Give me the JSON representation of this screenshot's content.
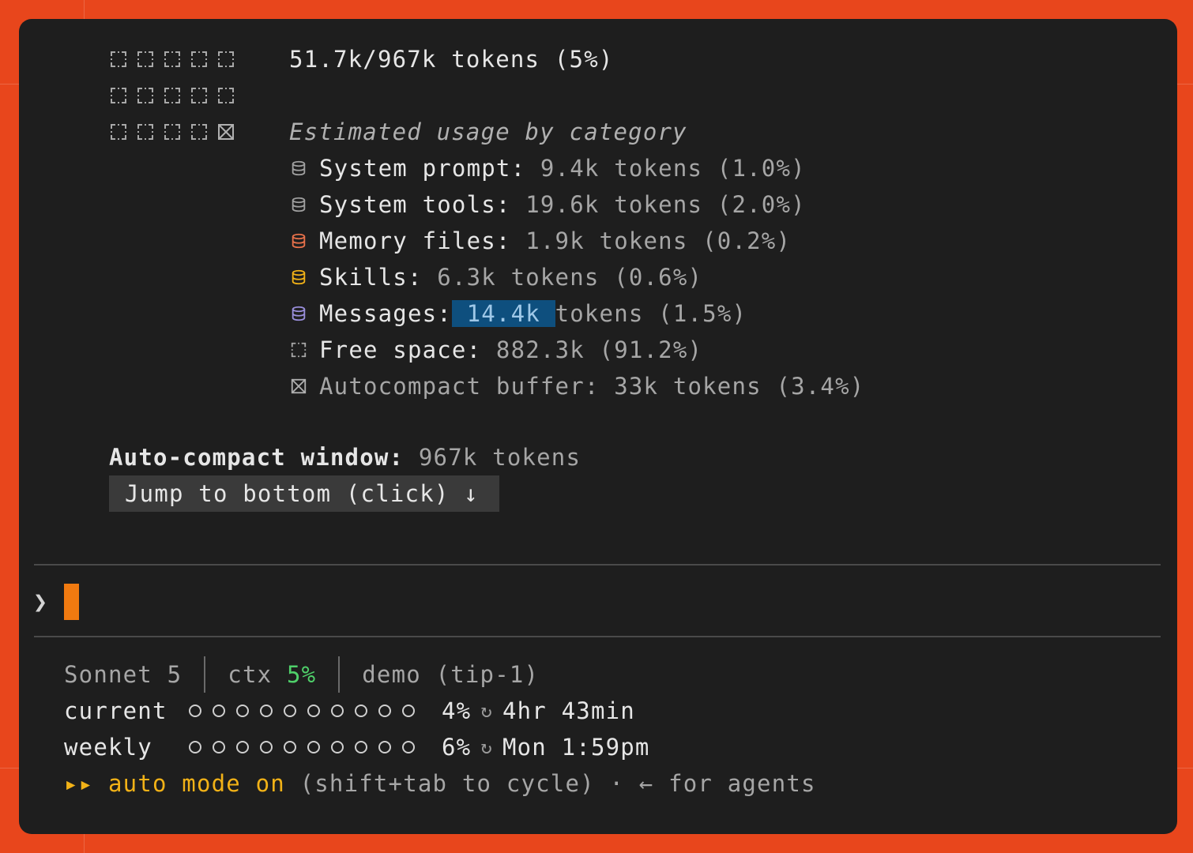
{
  "context": {
    "usage_summary": "51.7k/967k tokens (5%)",
    "heading": "Estimated usage by category",
    "grid": {
      "rows": [
        [
          "free",
          "free",
          "free",
          "free",
          "free"
        ],
        [
          "free",
          "free",
          "free",
          "free",
          "free"
        ],
        [
          "free",
          "free",
          "free",
          "free",
          "buffer"
        ]
      ]
    },
    "categories": [
      {
        "label": "System prompt:",
        "value": "9.4k tokens (1.0%)",
        "icon": "database-icon",
        "color": "#a0a0a0"
      },
      {
        "label": "System tools:",
        "value": "19.6k tokens (2.0%)",
        "icon": "database-icon",
        "color": "#a0a0a0"
      },
      {
        "label": "Memory files:",
        "value": "1.9k tokens (0.2%)",
        "icon": "database-icon",
        "color": "#e8714a"
      },
      {
        "label": "Skills:",
        "value": "6.3k tokens (0.6%)",
        "icon": "database-icon",
        "color": "#f2b217"
      },
      {
        "label": "Messages:",
        "value_highlight": "14.4k",
        "value_rest": "tokens (1.5%)",
        "icon": "database-icon",
        "color": "#9a8fdc"
      },
      {
        "label": "Free space:",
        "value": "882.3k (91.2%)",
        "icon": "free-space-icon",
        "color": "#a0a0a0"
      },
      {
        "label": "Autocompact buffer:",
        "value": "33k tokens (3.4%)",
        "icon": "buffer-icon",
        "color": "#a0a0a0"
      }
    ],
    "autocompact_label": "Auto-compact window:",
    "autocompact_value": "967k tokens",
    "jump_button": "Jump to bottom (click) ↓"
  },
  "prompt": {
    "glyph": "❯"
  },
  "statusline": {
    "model": "Sonnet 5",
    "ctx_label": "ctx",
    "ctx_value": "5%",
    "branch": "demo (tip-1)",
    "current_label": "current",
    "current_pct": "4%",
    "current_level": 0.04,
    "current_reset": "4hr 43min",
    "weekly_label": "weekly",
    "weekly_pct": "6%",
    "weekly_level": 0.06,
    "weekly_reset": "Mon 1:59pm",
    "mode_arrows": "▸▸",
    "mode_text": "auto mode on",
    "mode_hint": "(shift+tab to cycle) · ← for agents",
    "reset_icon": "↻"
  },
  "colors": {
    "accent": "#f07a10",
    "background": "#e8461c",
    "terminal": "#1e1e1e",
    "highlight": "#0e4f7e",
    "ok": "#4fd06a",
    "mode": "#f2b217"
  }
}
